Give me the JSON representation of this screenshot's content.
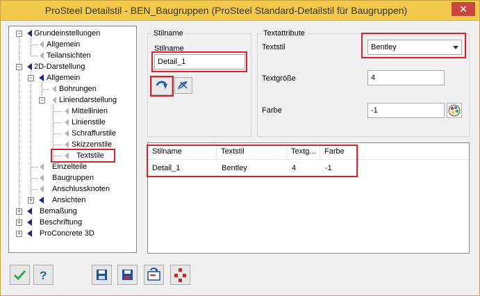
{
  "window": {
    "title": "ProSteel Detailstil - BEN_Baugruppen (ProSteel Standard-Detailstil für Baugruppen)",
    "close_label": "✕"
  },
  "tree": {
    "grundeinstellungen": "Grundeinstellungen",
    "allgemein1": "Allgemein",
    "teilansichten": "Teilansichten",
    "darstellung2d": "2D-Darstellung",
    "allgemein2": "Allgemein",
    "bohrungen": "Bohrungen",
    "liniendarstellung": "Liniendarstellung",
    "mittellinien": "Mittellinien",
    "linienstile": "Linienstile",
    "schraffurstile": "Schraffurstile",
    "skizzenstile": "Skizzenstile",
    "textstile": "Textstile",
    "einzelteile": "Einzelteile",
    "baugruppen": "Baugruppen",
    "anschlussknoten": "Anschlussknoten",
    "ansichten": "Ansichten",
    "bemassung": "Bemaßung",
    "beschriftung": "Beschriftung",
    "proconcrete": "ProConcrete 3D"
  },
  "stilname_group": {
    "title": "Stilname",
    "label": "Stilname",
    "value": "Detail_1"
  },
  "textattribute_group": {
    "title": "Textattribute",
    "textstil_label": "Textstil",
    "textstil_value": "Bentley",
    "textgroesse_label": "Textgröße",
    "textgroesse_value": "4",
    "farbe_label": "Farbe",
    "farbe_value": "-1"
  },
  "list": {
    "columns": [
      "Stilname",
      "Textstil",
      "Textg...",
      "Farbe"
    ],
    "rows": [
      {
        "stilname": "Detail_1",
        "textstil": "Bentley",
        "textgroesse": "4",
        "farbe": "-1"
      }
    ]
  },
  "colors": {
    "titlebar": "#f2c94b",
    "highlight": "#d2232a",
    "folder_icon": "#1c2a8a"
  }
}
